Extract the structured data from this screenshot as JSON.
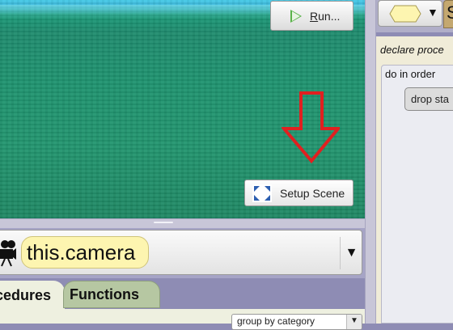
{
  "scene": {
    "run_button": {
      "label_mnemonic": "R",
      "label_rest": "un...",
      "icon": "play-icon"
    },
    "setup_scene_button": {
      "label": "Setup Scene",
      "icon": "expand-arrows-icon"
    },
    "arrow_annotation": {
      "icon": "down-arrow-icon",
      "color": "#e02020"
    }
  },
  "member_selector": {
    "value": "this.camera",
    "icon": "camera-icon",
    "dropdown_symbol": "▼"
  },
  "tabs": {
    "procedures_label": "cedures",
    "functions_label": "Functions"
  },
  "group_by": {
    "value": "group by category",
    "arrow": "▼"
  },
  "right_panel": {
    "type_dropdown_symbol": "▼",
    "tab_letter": "S",
    "declare_label": "declare proce",
    "do_in_order_label": "do in order",
    "drop_statement_label": "drop sta"
  },
  "colors": {
    "sky": "#42c8e6",
    "ground": "#1f8c6e",
    "panel": "#8e8cb4",
    "camera_pill": "#fdf5b0",
    "functions_tab": "#b6c7a2"
  }
}
